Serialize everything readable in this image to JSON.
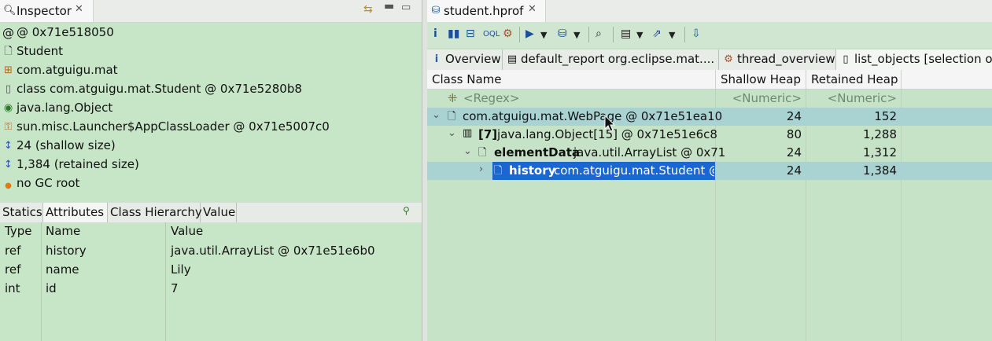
{
  "inspector": {
    "tab_title": "Inspector",
    "info": [
      {
        "icon": "at-icon",
        "text": "@ 0x71e518050"
      },
      {
        "icon": "file-icon",
        "text": "Student"
      },
      {
        "icon": "package-icon",
        "text": "com.atguigu.mat"
      },
      {
        "icon": "class-icon",
        "text": "class com.atguigu.mat.Student @ 0x71e5280b8"
      },
      {
        "icon": "superclass-icon",
        "text": "java.lang.Object"
      },
      {
        "icon": "classloader-icon",
        "text": "sun.misc.Launcher$AppClassLoader @ 0x71e5007c0"
      },
      {
        "icon": "size-icon",
        "text": "24 (shallow size)"
      },
      {
        "icon": "size-icon",
        "text": "1,384 (retained size)"
      },
      {
        "icon": "gc-root-icon",
        "text": "no GC root"
      }
    ],
    "attr_tabs": [
      "Statics",
      "Attributes",
      "Class Hierarchy",
      "Value"
    ],
    "selected_attr_tab": "Attributes",
    "columns": [
      "Type",
      "Name",
      "Value"
    ],
    "rows": [
      [
        "ref",
        "history",
        "java.util.ArrayList @ 0x71e51e6b0"
      ],
      [
        "ref",
        "name",
        "Lily"
      ],
      [
        "int",
        "id",
        "7"
      ]
    ]
  },
  "editor": {
    "tab_title": "student.hprof",
    "sub_tabs": [
      "Overview",
      "default_report  org.eclipse.mat....",
      "thread_overview",
      "list_objects  [selection o"
    ],
    "columns": [
      "Class Name",
      "Shallow Heap",
      "Retained Heap"
    ],
    "regex_row": {
      "name": "<Regex>",
      "shallow": "<Numeric>",
      "retained": "<Numeric>"
    },
    "rows": [
      {
        "twisty": "⌄",
        "prefix": "",
        "bold": "",
        "name": "com.atguigu.mat.WebPage @ 0x71e51ea10",
        "shallow": "24",
        "retained": "152"
      },
      {
        "twisty": "⌄",
        "prefix": "",
        "bold": "[7]",
        "name": "java.lang.Object[15] @ 0x71e51e6c8",
        "shallow": "80",
        "retained": "1,288"
      },
      {
        "twisty": "⌄",
        "prefix": "",
        "bold": "elementData",
        "name": "java.util.ArrayList @ 0x71",
        "shallow": "24",
        "retained": "1,312"
      },
      {
        "twisty": "›",
        "prefix": "",
        "bold": "history",
        "name": "com.atguigu.mat.Student @",
        "shallow": "24",
        "retained": "1,384"
      }
    ],
    "selected_row_index": 3
  },
  "colors": {
    "background": "#c7e3c7",
    "selection": "#1b66d0",
    "row_highlight": "#a9d3d3"
  }
}
